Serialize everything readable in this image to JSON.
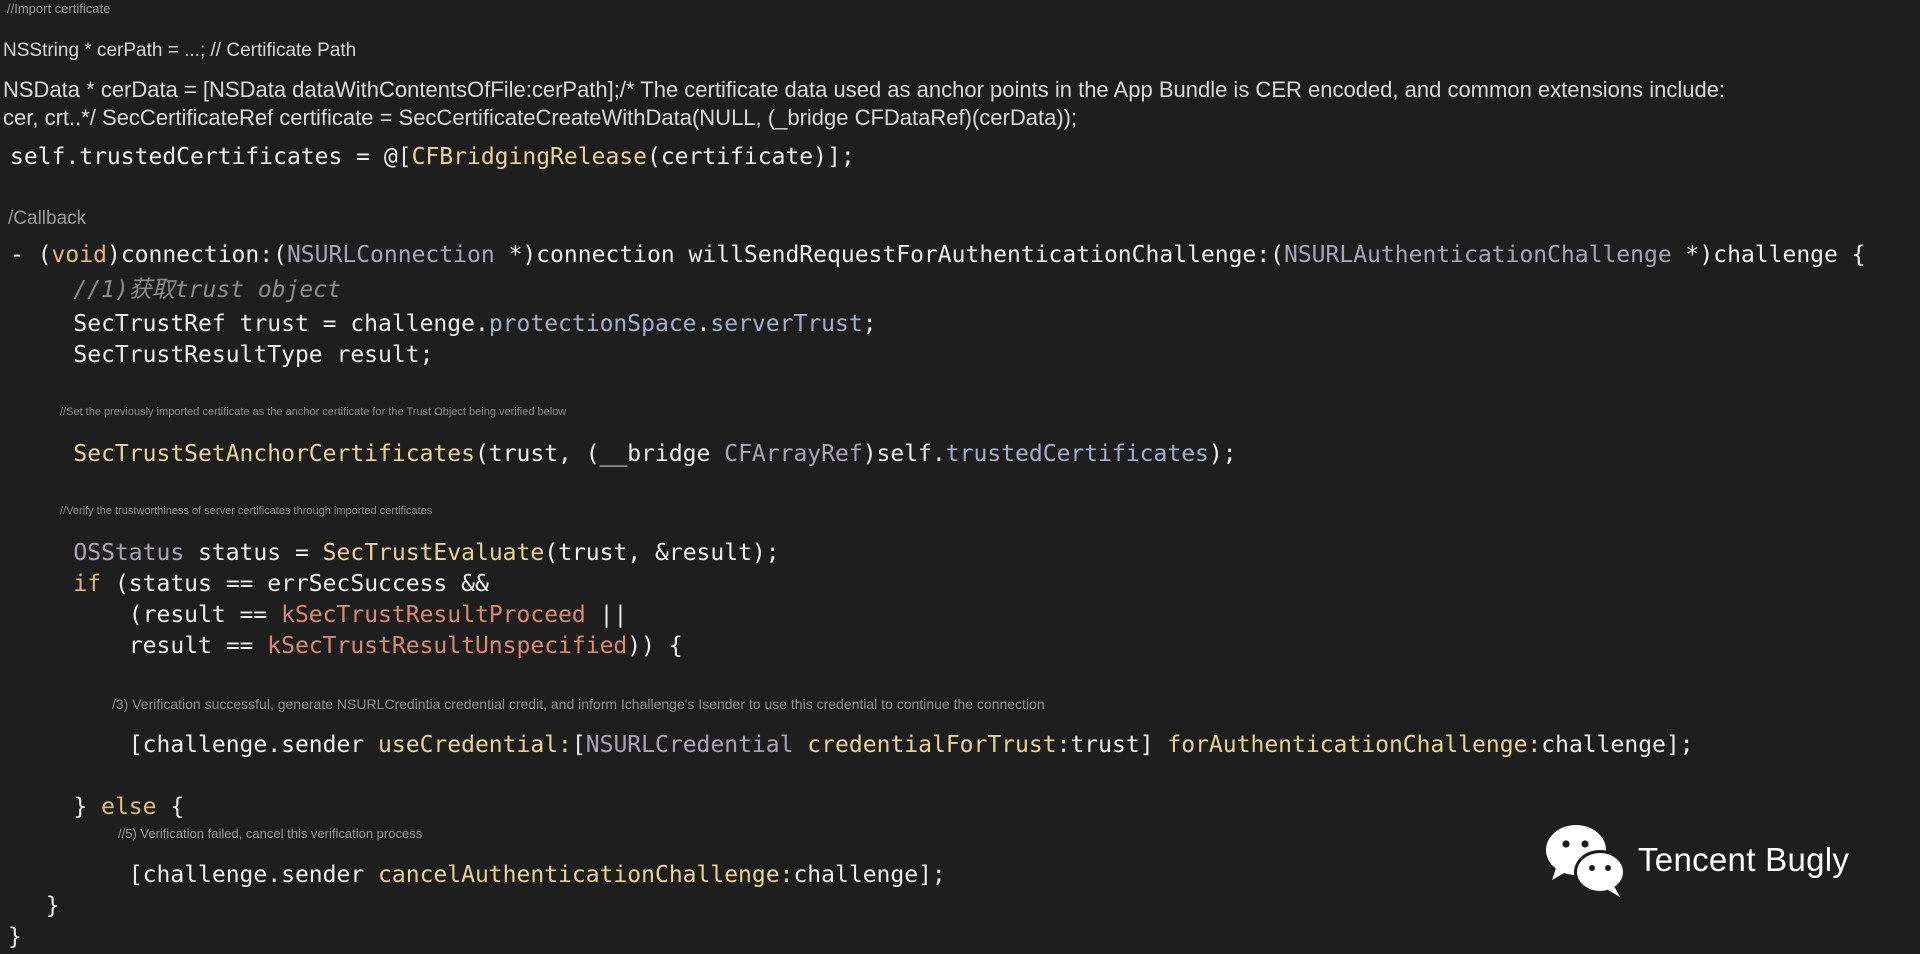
{
  "header": {
    "import_comment": "//Import certificate",
    "cer_path_line": "NSString * cerPath = ...; // Certificate Path",
    "cer_data_line_1": "NSData * cerData = [NSData dataWithContentsOfFile:cerPath];/* The certificate data used as anchor points in the App Bundle is CER encoded, and common extensions include:",
    "cer_data_line_2": "cer, crt..*/ SecCertificateRef certificate = SecCertificateCreateWithData(NULL, (_bridge CFDataRef)(cerData));"
  },
  "code": {
    "trusted_self": "self.trustedCertificates = @[",
    "trusted_fn": "CFBridgingRelease",
    "trusted_end": "(certificate)];",
    "callback_comment": "/Callback",
    "method_dash": "- (",
    "method_void": "void",
    "method_conn": ")connection:(",
    "method_nsurlconn": "NSURLConnection",
    "method_mid": " *)connection willSendRequestForAuthenticationChallenge:(",
    "method_nsurlauth": "NSURLAuthenticationChallenge",
    "method_end": " *)challenge {",
    "step1_comment": "    //1)获取trust object",
    "trust_decl": "    SecTrustRef trust = challenge.",
    "trust_ps": "protectionSpace",
    "trust_dot": ".",
    "trust_st": "serverTrust",
    "trust_semi": ";",
    "result_decl": "    SecTrustResultType result;",
    "anchor_comment": "//Set the previously imported certificate as the anchor certificate for the Trust Object being verified below",
    "anchor_indent": "    ",
    "anchor_fn": "SecTrustSetAnchorCertificates",
    "anchor_args": "(trust, (__bridge ",
    "anchor_type": "CFArrayRef",
    "anchor_self": ")self.",
    "anchor_prop": "trustedCertificates",
    "anchor_end": ");",
    "verify_comment": "//Verify the trustworthiness of server certificates through imported certificates",
    "status_indent": "    ",
    "status_type": "OSStatus",
    "status_mid": " status = ",
    "status_fn": "SecTrustEvaluate",
    "status_end": "(trust, &result);",
    "if_indent": "    ",
    "if_kw": "if",
    "if_rest": " (status == errSecSuccess &&",
    "proceed_pre": "        (result == ",
    "proceed_const": "kSecTrustResultProceed",
    "proceed_end": " ||",
    "unspec_pre": "        result == ",
    "unspec_const": "kSecTrustResultUnspecified",
    "unspec_end": ")) {",
    "success_comment": "/3) Verification successful, generate NSURLCredintia credential credit, and inform Ichallenge's Isender to use this credential to continue the connection",
    "use_pre": "        [challenge.sender ",
    "use_fn": "useCredential:",
    "use_bracket": "[",
    "use_type": "NSURLCredential",
    "use_sp": " ",
    "use_fn2": "credentialForTrust:",
    "use_trust": "trust] ",
    "use_fn3": "forAuthenticationChallenge:",
    "use_end": "challenge];",
    "else_pre": "    } ",
    "else_kw": "else",
    "else_end": " {",
    "fail_comment": "//5) Verification failed, cancel this verification process",
    "cancel_pre": "        [challenge.sender ",
    "cancel_fn": "cancelAuthenticationChallenge:",
    "cancel_end": "challenge];",
    "close_inner": "  }",
    "close_outer": "}"
  },
  "watermark": {
    "icon": "wechat-icon",
    "text": "Tencent Bugly"
  },
  "colors": {
    "background": "#1e1e1f",
    "keyword": "#e3b873",
    "type": "#a8a3b5",
    "function": "#e8d48c",
    "property": "#a0aec8",
    "constant": "#d98a6a"
  }
}
